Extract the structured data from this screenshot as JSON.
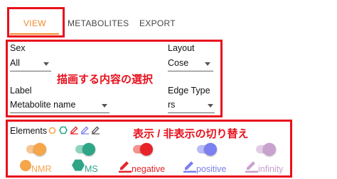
{
  "tabs": [
    {
      "label": "VIEW",
      "active": true
    },
    {
      "label": "METABOLITES",
      "active": false
    },
    {
      "label": "EXPORT",
      "active": false
    }
  ],
  "fields": {
    "sex": {
      "label": "Sex",
      "value": "All"
    },
    "layout": {
      "label": "Layout",
      "value": "Cose"
    },
    "node_label": {
      "label": "Label",
      "value": "Metabolite name"
    },
    "edge_type": {
      "label": "Edge Type",
      "value": "rs"
    }
  },
  "annotations": {
    "drawing": "描画する内容の選択",
    "toggle": "表示 / 非表示の切り替え"
  },
  "elements": {
    "title": "Elements",
    "items": [
      {
        "label": "NMR",
        "color": "#f5a54a",
        "icon": "circle-icon",
        "enabled": true
      },
      {
        "label": "MS",
        "color": "#2fa587",
        "icon": "hexagon-icon",
        "enabled": true
      },
      {
        "label": "negative",
        "color": "#e8232a",
        "icon": "pencil-icon",
        "enabled": true
      },
      {
        "label": "positive",
        "color": "#7b7ff0",
        "icon": "pencil-icon",
        "enabled": true
      },
      {
        "label": "infinity",
        "color": "#c9a1cf",
        "icon": "pencil-icon",
        "enabled": true
      }
    ]
  },
  "colors": {
    "accent": "#f08a2a",
    "highlight_frame": "#e8101c"
  }
}
